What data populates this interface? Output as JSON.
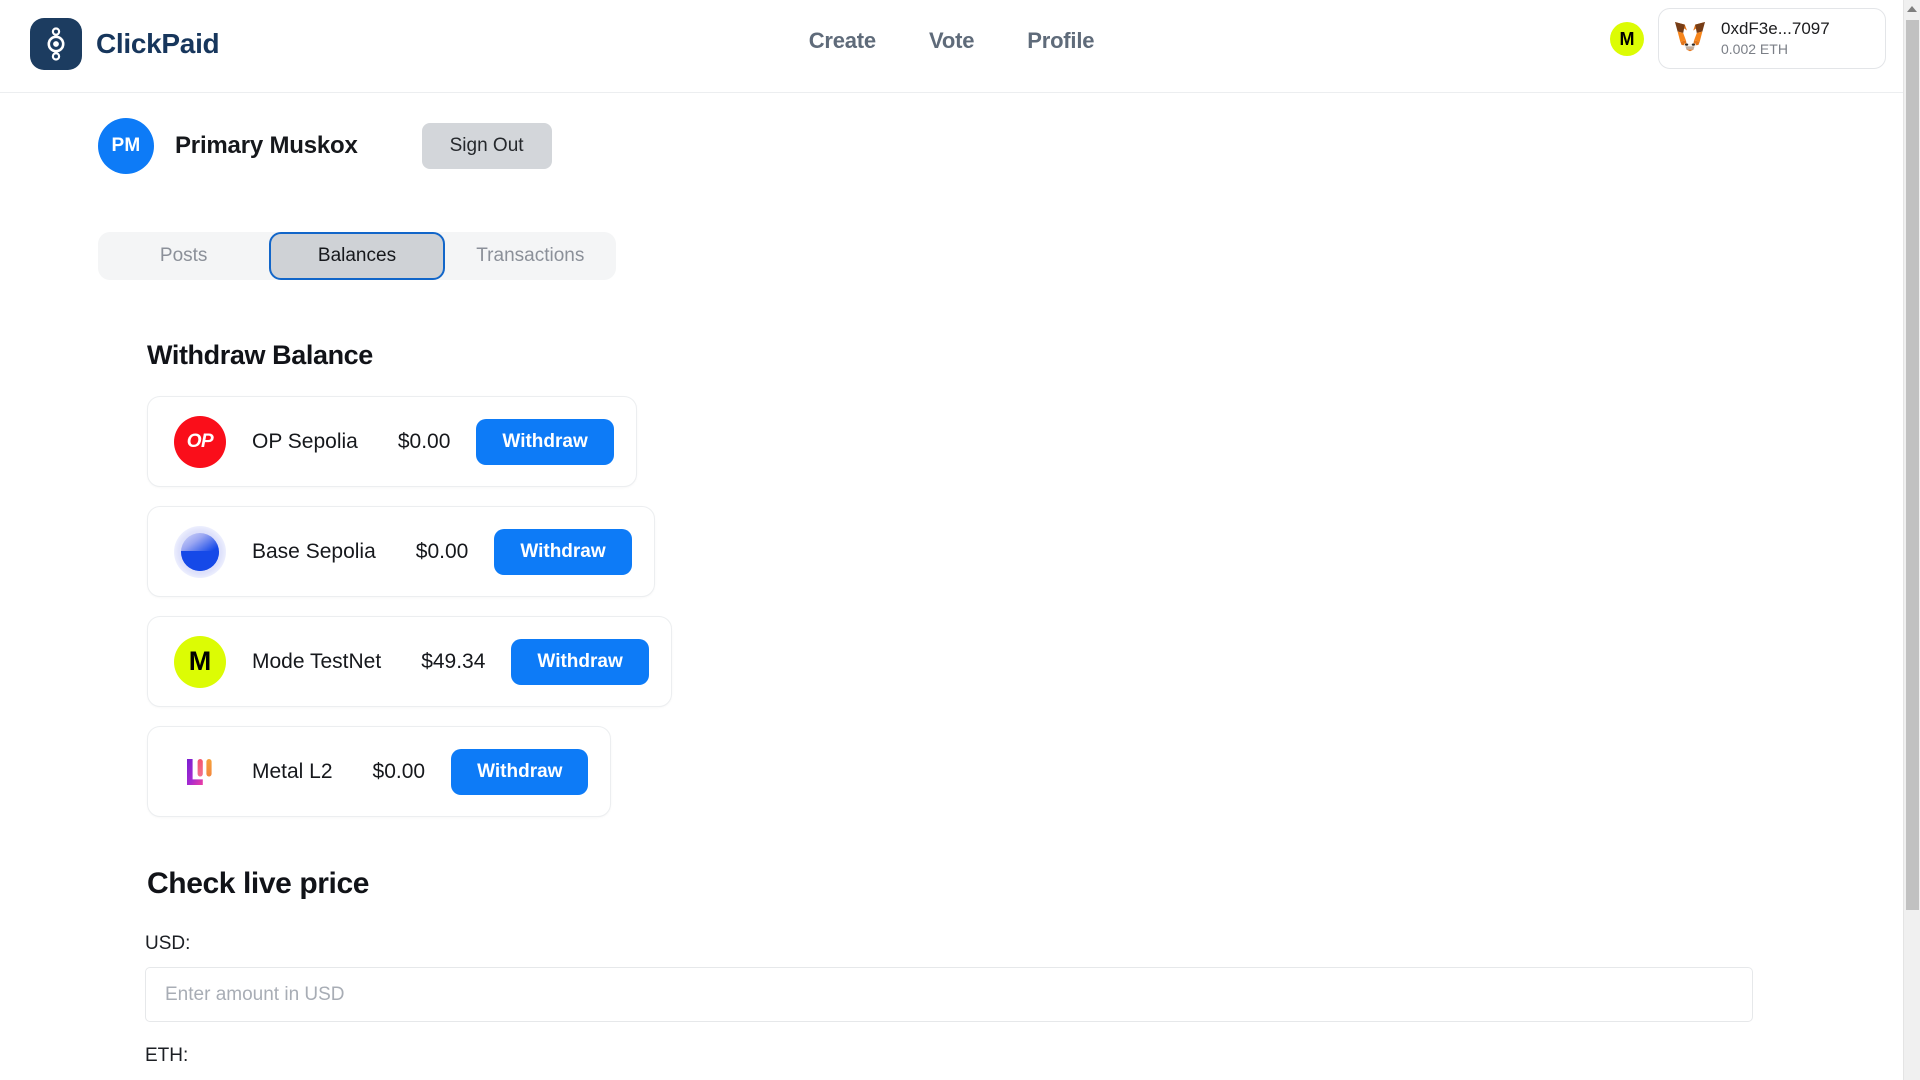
{
  "app": {
    "brand_name": "ClickPaid",
    "logo_icon": "clickpaid-logo-icon"
  },
  "nav": {
    "items": [
      {
        "label": "Create"
      },
      {
        "label": "Vote"
      },
      {
        "label": "Profile"
      }
    ]
  },
  "wallet": {
    "network_badge": "M",
    "network_badge_color": "#dcfc04",
    "provider_icon": "metamask-fox-icon",
    "address": "0xdF3e...7097",
    "balance": "0.002 ETH"
  },
  "profile": {
    "avatar_initials": "PM",
    "avatar_color": "#0d7bf7",
    "display_name": "Primary Muskox",
    "sign_out_label": "Sign Out"
  },
  "tabs": {
    "items": [
      {
        "label": "Posts",
        "active": false
      },
      {
        "label": "Balances",
        "active": true
      },
      {
        "label": "Transactions",
        "active": false
      }
    ]
  },
  "balances": {
    "title": "Withdraw Balance",
    "withdraw_label": "Withdraw",
    "accent_color": "#0d7bf7",
    "items": [
      {
        "chain": "OP Sepolia",
        "amount": "$0.00",
        "logo_icon": "op-sepolia-logo-icon",
        "logo_text": "OP",
        "logo_color": "#fa0e1a",
        "action_label": "Withdraw"
      },
      {
        "chain": "Base Sepolia",
        "amount": "$0.00",
        "logo_icon": "base-sepolia-logo-icon",
        "logo_text": "",
        "logo_color": "#1549e8",
        "action_label": "Withdraw"
      },
      {
        "chain": "Mode TestNet",
        "amount": "$49.34",
        "logo_icon": "mode-testnet-logo-icon",
        "logo_text": "M",
        "logo_color": "#dcfc04",
        "action_label": "Withdraw"
      },
      {
        "chain": "Metal L2",
        "amount": "$0.00",
        "logo_icon": "metal-l2-logo-icon",
        "logo_text": "",
        "logo_color": "#7a1fd1",
        "action_label": "Withdraw"
      }
    ]
  },
  "price_checker": {
    "title": "Check live price",
    "usd_label": "USD:",
    "usd_placeholder": "Enter amount in USD",
    "usd_value": "",
    "eth_label": "ETH:"
  },
  "scrollbar": {
    "up_arrow_icon": "scroll-up-arrow-icon"
  }
}
